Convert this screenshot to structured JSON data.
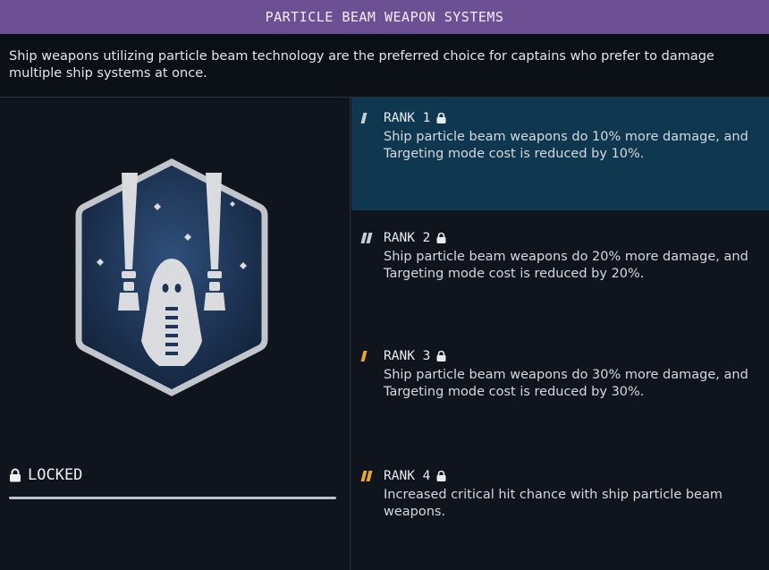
{
  "header": {
    "title": "PARTICLE BEAM WEAPON SYSTEMS",
    "description": "Ship weapons utilizing particle beam technology are the preferred choice for captains who prefer to damage multiple ship systems at once."
  },
  "status": {
    "label": "LOCKED",
    "icon": "lock-icon"
  },
  "ranks": [
    {
      "label": "RANK 1",
      "pips": 1,
      "pip_color": "#c9ccd1",
      "description": "Ship particle beam weapons do 10% more damage, and Targeting mode cost is reduced by 10%.",
      "selected": true
    },
    {
      "label": "RANK 2",
      "pips": 2,
      "pip_color": "#c9ccd1",
      "description": "Ship particle beam weapons do 20% more damage, and Targeting mode cost is reduced by 20%.",
      "selected": false
    },
    {
      "label": "RANK 3",
      "pips": 1,
      "pip_color": "#e8a531",
      "description": "Ship particle beam weapons do 30% more damage, and Targeting mode cost is reduced by 30%.",
      "selected": false
    },
    {
      "label": "RANK 4",
      "pips": 2,
      "pip_color": "#e8a531",
      "description": "Increased critical hit chance with ship particle beam weapons.",
      "selected": false
    }
  ],
  "colors": {
    "title_bar": "#6d4f93",
    "selected_rank": "#0f3750",
    "background": "#0f141d",
    "badge_fill": "#1d3558",
    "badge_border": "#c2c6cc"
  },
  "badge": {
    "icon": "particle-beam-badge-icon"
  }
}
